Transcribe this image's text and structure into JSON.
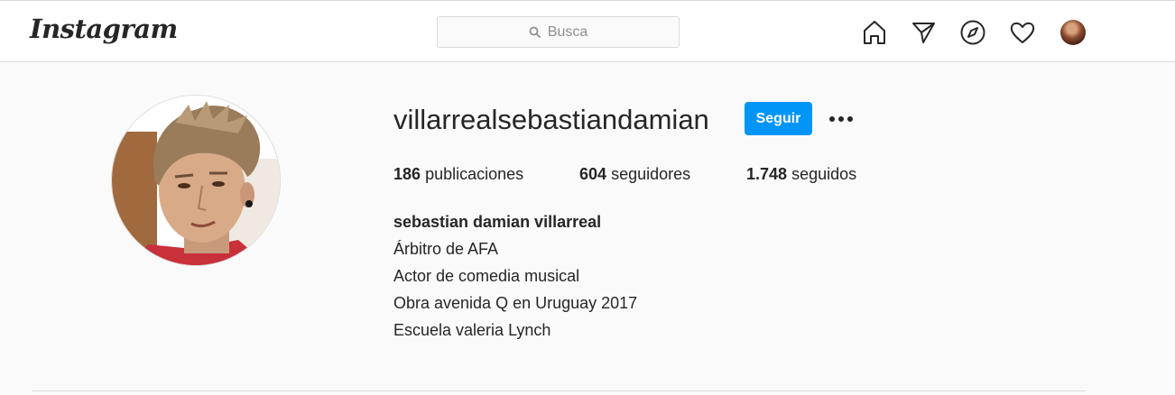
{
  "header": {
    "logo_text": "Instagram",
    "search_placeholder": "Busca",
    "icons": [
      "home-icon",
      "direct-message-icon",
      "explore-icon",
      "activity-heart-icon",
      "profile-avatar"
    ]
  },
  "profile": {
    "username": "villarrealsebastiandamian",
    "follow_label": "Seguir",
    "more_label": "•••",
    "stats": {
      "posts_count": "186",
      "posts_label": "publicaciones",
      "followers_count": "604",
      "followers_label": "seguidores",
      "following_count": "1.748",
      "following_label": "seguidos"
    },
    "full_name": "sebastian damian villarreal",
    "bio_lines": [
      "Árbitro de AFA",
      "Actor de comedia musical",
      "Obra avenida Q en Uruguay 2017",
      "Escuela valeria Lynch"
    ]
  },
  "colors": {
    "accent": "#0095f6",
    "background": "#fafafa",
    "border": "#dbdbdb",
    "text": "#262626"
  }
}
